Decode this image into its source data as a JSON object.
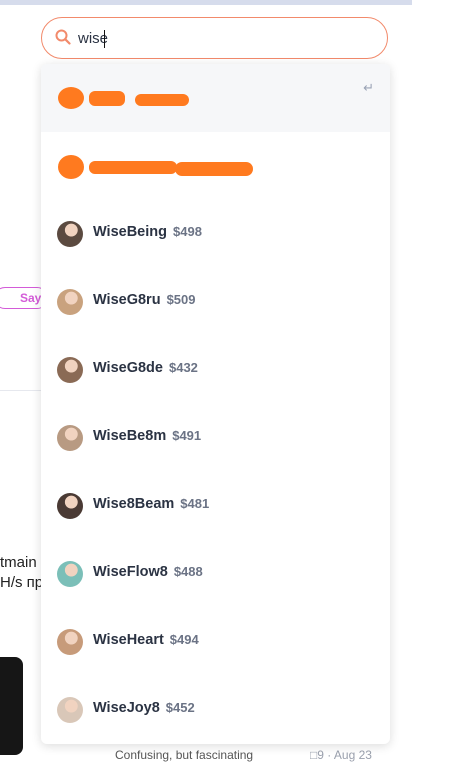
{
  "search": {
    "value": "wise",
    "accent": "#f28a6b"
  },
  "dropdown": {
    "enter_hint": "↵",
    "users": [
      {
        "name": "WiseBeing",
        "price": "$498",
        "avatar_color": "#5b4a40"
      },
      {
        "name": "WiseG8ru",
        "price": "$509",
        "avatar_color": "#c9a27e"
      },
      {
        "name": "WiseG8de",
        "price": "$432",
        "avatar_color": "#8a6a55"
      },
      {
        "name": "WiseBe8m",
        "price": "$491",
        "avatar_color": "#b89a82"
      },
      {
        "name": "Wise8Beam",
        "price": "$481",
        "avatar_color": "#4a3a34"
      },
      {
        "name": "WiseFlow8",
        "price": "$488",
        "avatar_color": "#7bbfb8"
      },
      {
        "name": "WiseHeart",
        "price": "$494",
        "avatar_color": "#c79b7a"
      },
      {
        "name": "WiseJoy8",
        "price": "$452",
        "avatar_color": "#d9c7b8"
      }
    ]
  },
  "background": {
    "pill_label": "Say",
    "text_line1": "tmain",
    "text_line2": "H/s пр",
    "footer_text": "Confusing, but fascinating",
    "footer_meta": "□9 · Aug 23"
  }
}
